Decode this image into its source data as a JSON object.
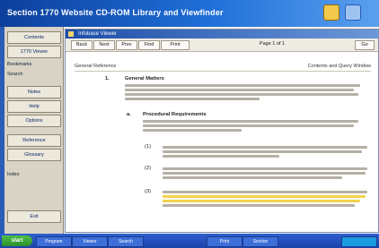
{
  "banner": {
    "title": "Section 1770 Website CD-ROM Library and Viewfinder"
  },
  "panel": {
    "title": "Infobase Viewer"
  },
  "toolbar": {
    "buttons": [
      "Back",
      "Next",
      "Prev",
      "Find",
      "Print"
    ],
    "page_label": "Page 1 of 1",
    "go": "Go"
  },
  "address": {
    "left": "General Reference",
    "right": "Contents and Query Window"
  },
  "sidebar": {
    "items": [
      "Contents",
      "1770 Viewer",
      "Bookmarks",
      "Search",
      "Notes",
      "Help",
      "Options",
      "Reference",
      "Glossary",
      "Index",
      "Exit"
    ]
  },
  "doc": {
    "section_num": "1.",
    "section_title": "General Matters",
    "sub_num": "a.",
    "sub_title": "Procedural Requirements",
    "items": [
      "(1)",
      "(2)",
      "(3)"
    ]
  },
  "taskbar": {
    "start": "start",
    "tasks": [
      "Program",
      "Viewer",
      "Search",
      "Print",
      "Section"
    ]
  }
}
